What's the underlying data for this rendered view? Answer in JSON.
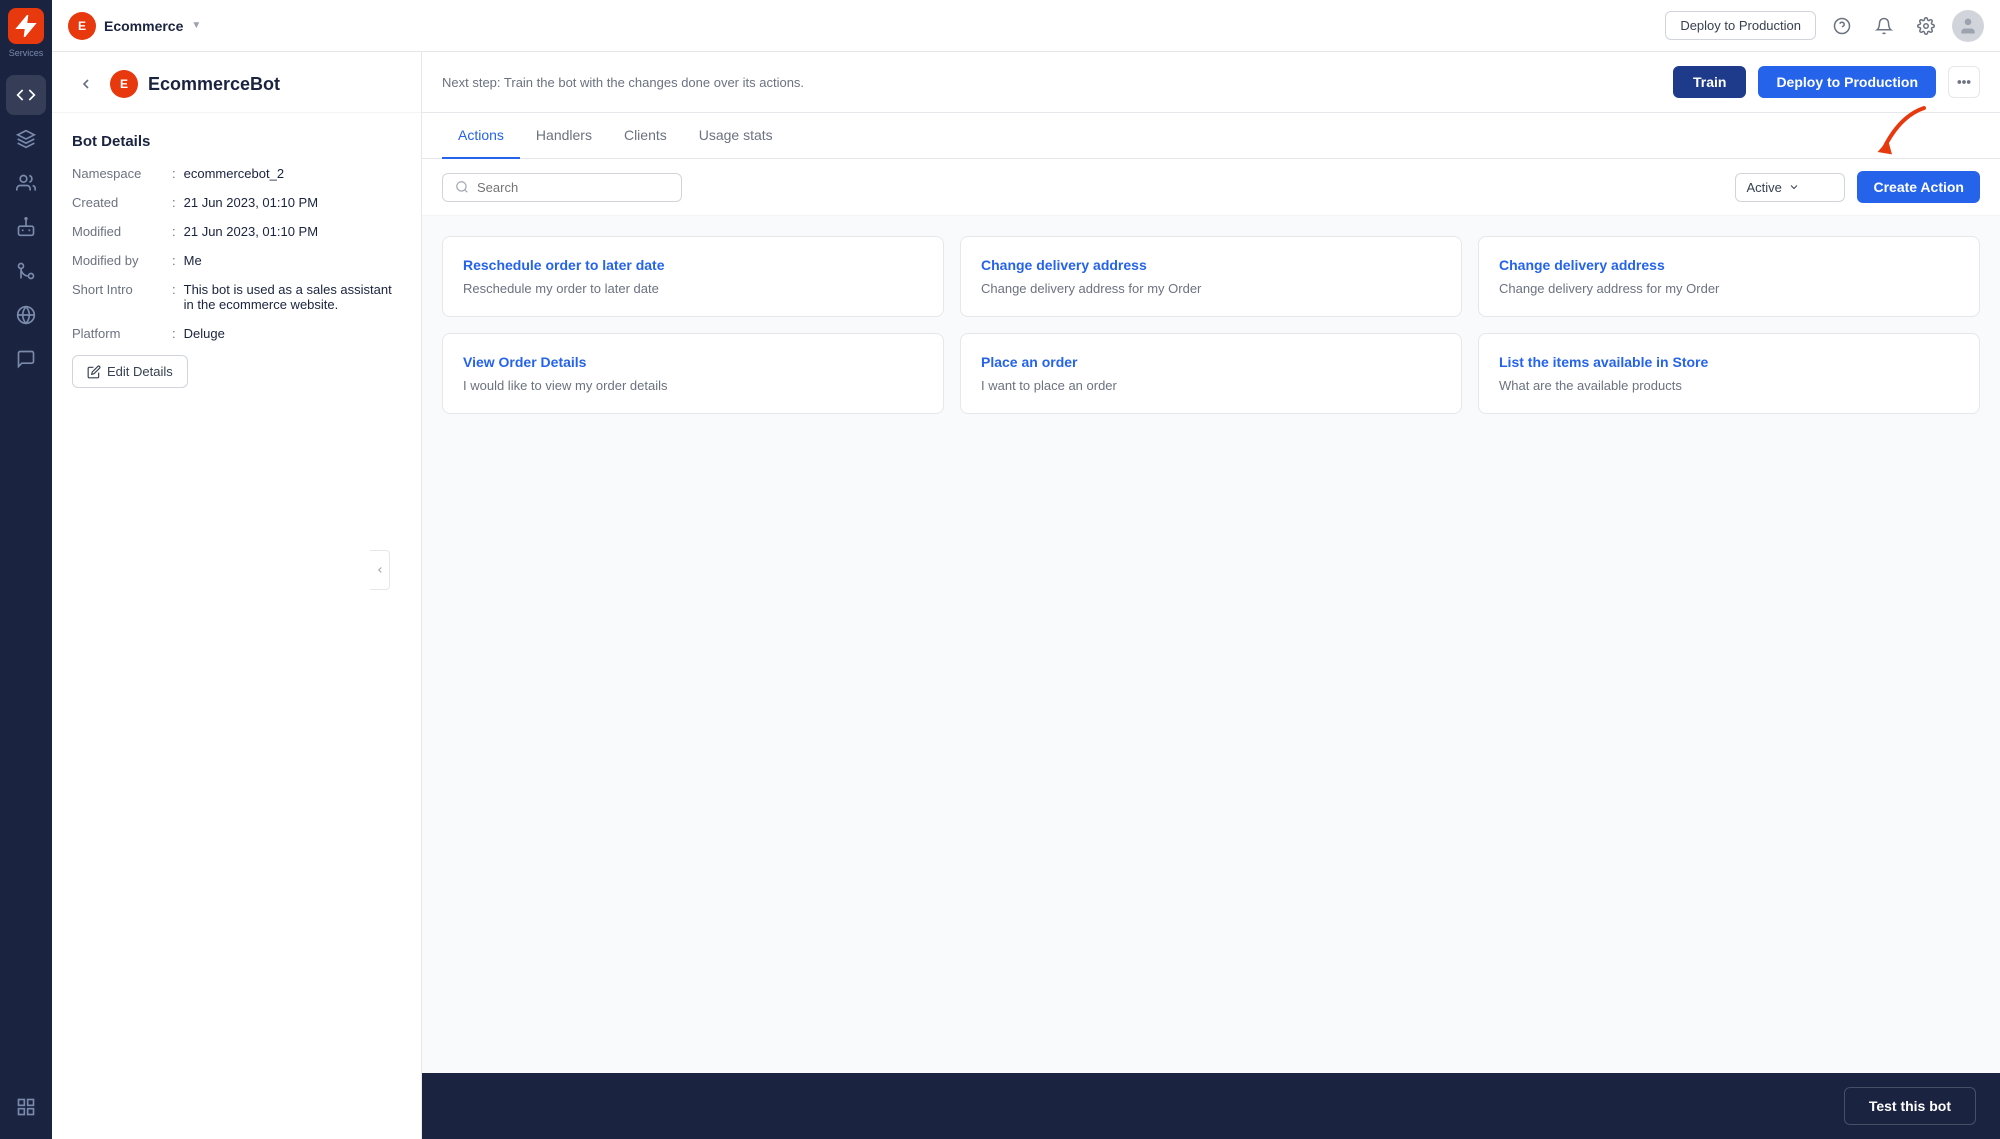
{
  "topbar": {
    "brand_letter": "E",
    "brand_name": "Ecommerce",
    "deploy_outline_label": "Deploy to Production",
    "chevron": "▼"
  },
  "left_panel": {
    "bot_letter": "E",
    "bot_name": "EcommerceBot",
    "section_title": "Bot Details",
    "details": [
      {
        "label": "Namespace",
        "colon": ":",
        "value": "ecommercebot_2"
      },
      {
        "label": "Created",
        "colon": ":",
        "value": "21 Jun 2023, 01:10 PM"
      },
      {
        "label": "Modified",
        "colon": ":",
        "value": "21 Jun 2023, 01:10 PM"
      },
      {
        "label": "Modified by",
        "colon": ":",
        "value": "Me"
      },
      {
        "label": "Short Intro",
        "colon": ":",
        "value": "This bot is used as a sales assistant in the ecommerce website."
      },
      {
        "label": "Platform",
        "colon": ":",
        "value": "Deluge"
      }
    ],
    "edit_btn": "Edit Details"
  },
  "action_bar": {
    "next_step_text": "Next step: Train the bot with the changes done over its actions.",
    "train_label": "Train",
    "deploy_label": "Deploy to Production"
  },
  "tabs": [
    {
      "label": "Actions",
      "active": true
    },
    {
      "label": "Handlers",
      "active": false
    },
    {
      "label": "Clients",
      "active": false
    },
    {
      "label": "Usage stats",
      "active": false
    }
  ],
  "filter": {
    "search_placeholder": "Search",
    "status_label": "Active",
    "create_action_label": "Create Action"
  },
  "actions": [
    {
      "title": "Reschedule order to later date",
      "desc": "Reschedule my order to later date"
    },
    {
      "title": "Change delivery address",
      "desc": "Change delivery address for my Order"
    },
    {
      "title": "Change delivery address",
      "desc": "Change delivery address for my Order"
    },
    {
      "title": "View Order Details",
      "desc": "I would like to view my order details"
    },
    {
      "title": "Place an order",
      "desc": "I want to place an order"
    },
    {
      "title": "List the items available in Store",
      "desc": "What are the available products"
    }
  ],
  "test_bot": {
    "label": "Test this bot"
  },
  "sidebar_label": "Services"
}
